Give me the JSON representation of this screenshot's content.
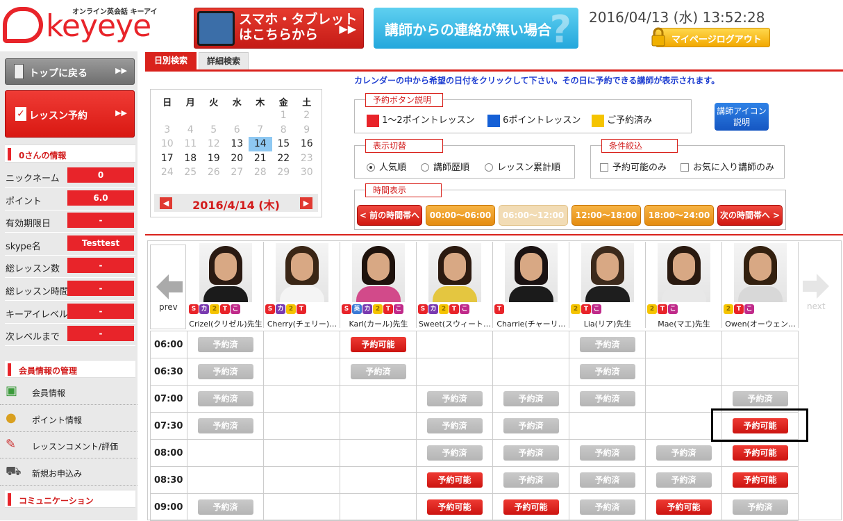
{
  "header": {
    "logo_text": "keyeye",
    "logo_sub": "オンライン英会話 キーアイ",
    "banner_smartphone": [
      "スマホ・タブレット",
      "はこちらから"
    ],
    "banner_contact": "講師からの連絡が無い場合",
    "datetime": "2016/04/13 (水) 13:52:28",
    "logout": "マイページログアウト"
  },
  "sidebar": {
    "top_button": "トップに戻る",
    "lesson_button": "レッスン予約",
    "user_section": "0さんの情報",
    "info": [
      {
        "key": "ニックネーム",
        "value": "0"
      },
      {
        "key": "ポイント",
        "value": "6.0"
      },
      {
        "key": "有効期限日",
        "value": "-"
      },
      {
        "key": "skype名",
        "value": "Testtest"
      },
      {
        "key": "総レッスン数",
        "value": "-"
      },
      {
        "key": "総レッスン時間",
        "value": "-"
      },
      {
        "key": "キーアイレベル",
        "value": "-"
      },
      {
        "key": "次レベルまで",
        "value": "-"
      }
    ],
    "member_section": "会員情報の管理",
    "menu": [
      {
        "label": "会員情報",
        "icon": "member-card-icon"
      },
      {
        "label": "ポイント情報",
        "icon": "coins-icon"
      },
      {
        "label": "レッスンコメント/評価",
        "icon": "pen-note-icon"
      },
      {
        "label": "新規お申込み",
        "icon": "cart-icon"
      }
    ],
    "comm_section": "コミュニケーション"
  },
  "tabs": {
    "daily": "日別検索",
    "detail": "詳細検索"
  },
  "instruction": "カレンダーの中から希望の日付をクリックして下さい。その日に予約できる講師が表示されます。",
  "calendar": {
    "weekdays": [
      "日",
      "月",
      "火",
      "水",
      "木",
      "金",
      "土"
    ],
    "weeks": [
      [
        {
          "d": ""
        },
        {
          "d": ""
        },
        {
          "d": ""
        },
        {
          "d": ""
        },
        {
          "d": ""
        },
        {
          "d": "1",
          "s": "o"
        },
        {
          "d": "2",
          "s": "o"
        }
      ],
      [
        {
          "d": "3",
          "s": "o"
        },
        {
          "d": "4",
          "s": "o"
        },
        {
          "d": "5",
          "s": "o"
        },
        {
          "d": "6",
          "s": "o"
        },
        {
          "d": "7",
          "s": "o"
        },
        {
          "d": "8",
          "s": "o"
        },
        {
          "d": "9",
          "s": "o"
        }
      ],
      [
        {
          "d": "10",
          "s": "o"
        },
        {
          "d": "11",
          "s": "o"
        },
        {
          "d": "12",
          "s": "o"
        },
        {
          "d": "13",
          "s": "c"
        },
        {
          "d": "14",
          "s": "sel"
        },
        {
          "d": "15",
          "s": "c"
        },
        {
          "d": "16",
          "s": "c"
        }
      ],
      [
        {
          "d": "17",
          "s": "c"
        },
        {
          "d": "18",
          "s": "c"
        },
        {
          "d": "19",
          "s": "c"
        },
        {
          "d": "20",
          "s": "c"
        },
        {
          "d": "21",
          "s": "c"
        },
        {
          "d": "22",
          "s": "c"
        },
        {
          "d": "23",
          "s": "o"
        }
      ],
      [
        {
          "d": "24",
          "s": "o"
        },
        {
          "d": "25",
          "s": "o"
        },
        {
          "d": "26",
          "s": "o"
        },
        {
          "d": "27",
          "s": "o"
        },
        {
          "d": "28",
          "s": "o"
        },
        {
          "d": "29",
          "s": "o"
        },
        {
          "d": "30",
          "s": "o"
        }
      ]
    ],
    "selected_date": "2016/4/14 (木)"
  },
  "legend": {
    "title": "予約ボタン説明",
    "items": [
      {
        "label": "1～2ポイントレッスン",
        "color": "#e8242a"
      },
      {
        "label": "6ポイントレッスン",
        "color": "#1560d6"
      },
      {
        "label": "ご予約済み",
        "color": "#f5c400"
      }
    ],
    "icon_help": [
      "講師アイコン",
      "説明"
    ]
  },
  "display": {
    "title": "表示切替",
    "options": [
      "人気順",
      "講師歴順",
      "レッスン累計順"
    ],
    "selected": 0
  },
  "filter": {
    "title": "条件絞込",
    "options": [
      "予約可能のみ",
      "お気に入り講師のみ"
    ]
  },
  "time": {
    "title": "時間表示",
    "buttons": [
      {
        "label": "< 前の時間帯へ",
        "style": "red"
      },
      {
        "label": "00:00～06:00",
        "style": "orange"
      },
      {
        "label": "06:00～12:00",
        "style": "disabled"
      },
      {
        "label": "12:00～18:00",
        "style": "orange"
      },
      {
        "label": "18:00～24:00",
        "style": "orange"
      },
      {
        "label": "次の時間帯へ >",
        "style": "red"
      }
    ]
  },
  "schedule": {
    "prev": "prev",
    "next": "next",
    "teachers": [
      {
        "name": "Crizel(クリゼル)先生",
        "badges": [
          "S",
          "カ",
          "2",
          "T",
          "こ"
        ]
      },
      {
        "name": "Cherry(チェリー)…",
        "badges": [
          "S",
          "カ",
          "2",
          "T"
        ]
      },
      {
        "name": "Karl(カール)先生",
        "badges": [
          "S",
          "英",
          "カ",
          "2",
          "T",
          "こ"
        ]
      },
      {
        "name": "Sweet(スウィート…",
        "badges": [
          "S",
          "カ",
          "2",
          "T",
          "こ"
        ]
      },
      {
        "name": "Charrie(チャーリ…",
        "badges": [
          "T"
        ]
      },
      {
        "name": "Lia(リア)先生",
        "badges": [
          "2",
          "T",
          "こ"
        ]
      },
      {
        "name": "Mae(マエ)先生",
        "badges": [
          "2",
          "T",
          "こ"
        ]
      },
      {
        "name": "Owen(オーウェン…",
        "badges": [
          "2",
          "T",
          "こ"
        ]
      }
    ],
    "labels": {
      "b": "予約済",
      "a": "予約可能"
    },
    "rows": [
      {
        "time": "06:00",
        "slots": [
          "b",
          "",
          "a",
          "",
          "",
          "b",
          "",
          ""
        ]
      },
      {
        "time": "06:30",
        "slots": [
          "b",
          "",
          "b",
          "",
          "",
          "b",
          "",
          ""
        ]
      },
      {
        "time": "07:00",
        "slots": [
          "b",
          "",
          "",
          "b",
          "b",
          "b",
          "",
          "b"
        ]
      },
      {
        "time": "07:30",
        "slots": [
          "b",
          "",
          "",
          "b",
          "b",
          "",
          "",
          "a"
        ]
      },
      {
        "time": "08:00",
        "slots": [
          "",
          "",
          "",
          "b",
          "b",
          "b",
          "b",
          "a"
        ]
      },
      {
        "time": "08:30",
        "slots": [
          "",
          "",
          "",
          "a",
          "b",
          "b",
          "b",
          "a"
        ]
      },
      {
        "time": "09:00",
        "slots": [
          "b",
          "",
          "",
          "a",
          "a",
          "b",
          "a",
          "b"
        ]
      }
    ]
  }
}
